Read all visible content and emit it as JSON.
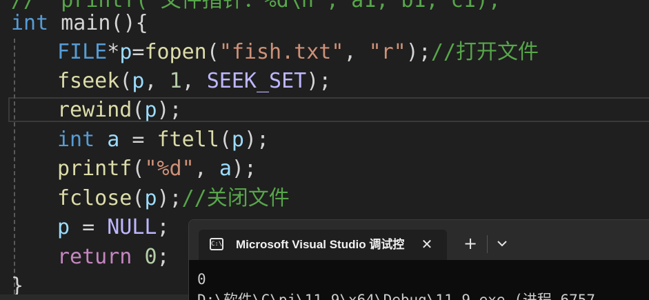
{
  "editor": {
    "line_top_partial": "//  printf(\"文件指针：%d\\n\", a1, b1, c1);",
    "line_main_kw": "int",
    "line_main_rest": " main(){",
    "line_file_type": "FILE",
    "line_file_star": "*",
    "line_file_var": "p",
    "line_file_eq": "=",
    "line_file_fn": "fopen",
    "line_file_open": "(",
    "line_file_str1": "\"fish.txt\"",
    "line_file_comma": ", ",
    "line_file_str2": "\"r\"",
    "line_file_close": ");",
    "line_file_comment": "//打开文件",
    "line_fseek_fn": "fseek",
    "line_fseek_open": "(",
    "line_fseek_var": "p",
    "line_fseek_comma1": ", ",
    "line_fseek_num": "1",
    "line_fseek_comma2": ", ",
    "line_fseek_macro": "SEEK_SET",
    "line_fseek_close": ");",
    "line_rewind_fn": "rewind",
    "line_rewind_open": "(",
    "line_rewind_var": "p",
    "line_rewind_close": ");",
    "line_ftell_kw": "int",
    "line_ftell_var": " a",
    "line_ftell_eq": " = ",
    "line_ftell_fn": "ftell",
    "line_ftell_open": "(",
    "line_ftell_arg": "p",
    "line_ftell_close": ");",
    "line_printf_fn": "printf",
    "line_printf_open": "(",
    "line_printf_str": "\"%d\"",
    "line_printf_comma": ", ",
    "line_printf_var": "a",
    "line_printf_close": ");",
    "line_fclose_fn": "fclose",
    "line_fclose_open": "(",
    "line_fclose_var": "p",
    "line_fclose_close": ");",
    "line_fclose_comment": "//关闭文件",
    "line_null_var": "p",
    "line_null_eq": " = ",
    "line_null_macro": "NULL",
    "line_null_semi": ";",
    "line_return_kw": "return",
    "line_return_sp": " ",
    "line_return_num": "0",
    "line_return_semi": ";",
    "line_brace": "}"
  },
  "terminal": {
    "tab_title": "Microsoft Visual Studio 调试控",
    "tab_icon_glyph": "C:\\",
    "close_glyph": "✕",
    "new_tab_glyph": "+",
    "output_line1": "0",
    "output_line2": "D:\\软件\\C\\pj\\11.9\\x64\\Debug\\11.9.exe (进程 6757"
  },
  "colors": {
    "background": "#1f1f1f",
    "keyword": "#569cd6",
    "control_keyword": "#c586c0",
    "function": "#dcdcaa",
    "variable": "#9cdcfe",
    "macro": "#beb7ff",
    "string": "#ce9178",
    "number": "#b5cea8",
    "comment": "#57a64a",
    "terminal_background": "#0c0c0c"
  }
}
